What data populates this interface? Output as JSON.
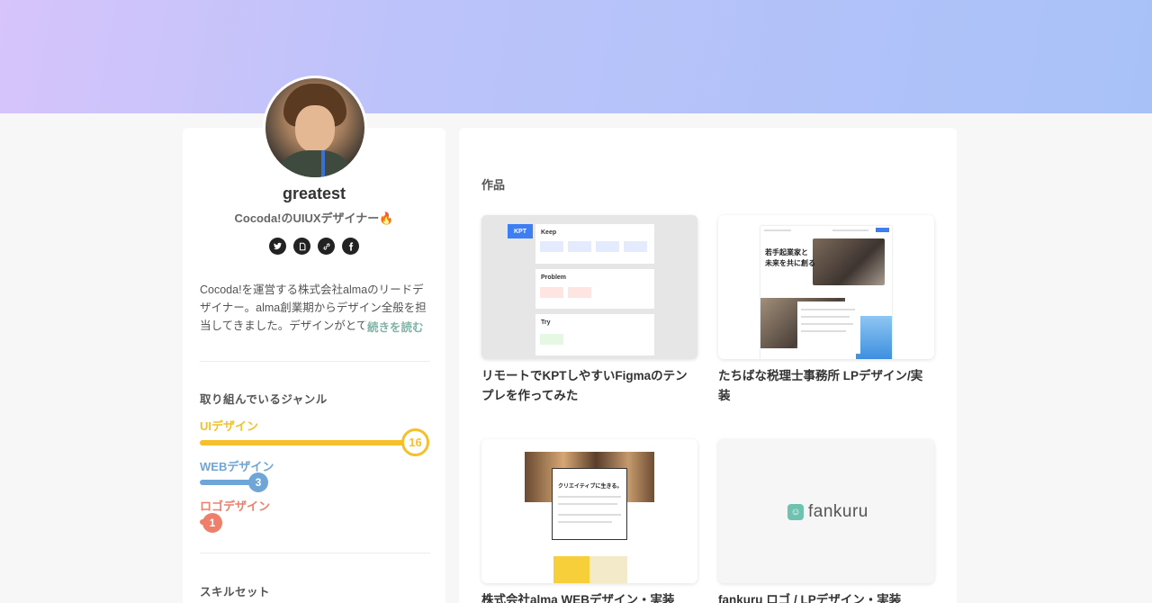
{
  "profile": {
    "username": "greatest",
    "tagline": "Cocoda!のUIUXデザイナー🔥",
    "bio": "Cocoda!を運営する株式会社almaのリードデザイナー。alma創業期からデザイン全般を担当してきました。デザインがとても好きです。",
    "read_more": "続きを読む",
    "socials": [
      "twitter-icon",
      "note-icon",
      "link-icon",
      "facebook-icon"
    ]
  },
  "genres": {
    "title": "取り組んでいるジャンル",
    "items": [
      {
        "label": "UIデザイン",
        "count": "16",
        "color": "#f5c02a",
        "fraction": 1.0
      },
      {
        "label": "WEBデザイン",
        "count": "3",
        "color": "#6ea6d8",
        "fraction": 0.19
      },
      {
        "label": "ロゴデザイン",
        "count": "1",
        "color": "#ee7f6b",
        "fraction": 0.06
      }
    ]
  },
  "skills": {
    "title": "スキルセット"
  },
  "works": {
    "title": "作品",
    "items": [
      {
        "title": "リモートでKPTしやすいFigmaのテンプレを作ってみた"
      },
      {
        "title": "たちばな税理士事務所 LPデザイン/実装"
      },
      {
        "title": "株式会社alma WEBデザイン・実装"
      },
      {
        "title": "fankuru ロゴ / LPデザイン・実装"
      }
    ],
    "kpt": {
      "badge": "KPT",
      "keep": "Keep",
      "problem": "Problem",
      "try": "Try"
    },
    "lp_hero": "若手起業家と\n未来を共に創る",
    "alma_copy": "クリエイティブに生きる。",
    "fankuru_logo": "fankuru"
  },
  "colors": {
    "banner_start": "#d6c4fb",
    "banner_end": "#a8c2f8",
    "read_more": "#7fb3a5"
  }
}
